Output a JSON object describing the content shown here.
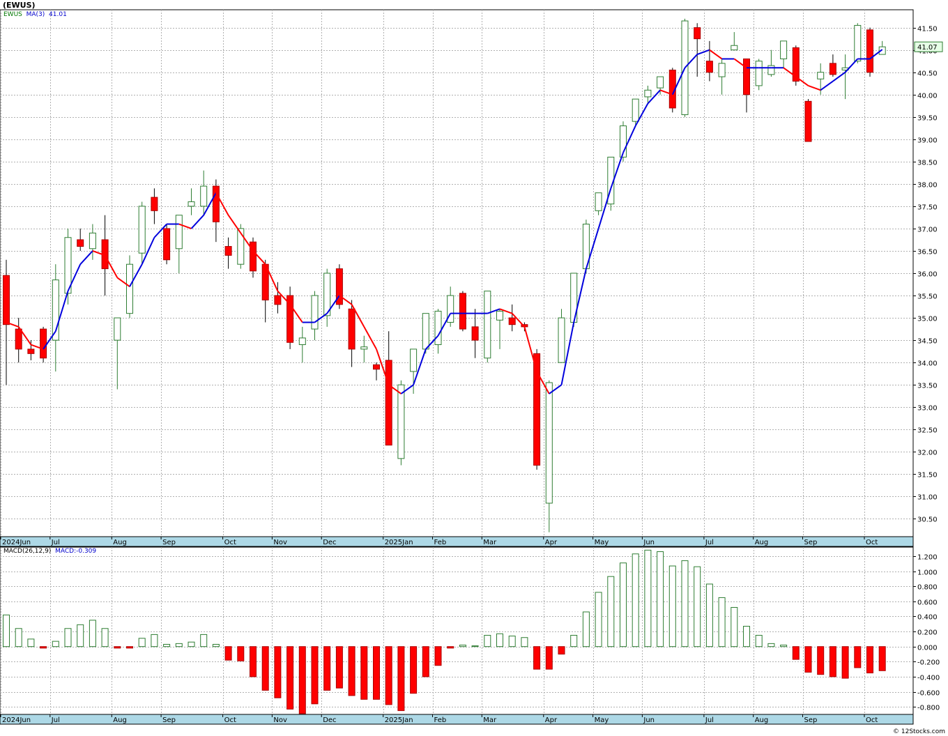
{
  "title": "(EWUS)",
  "price_legend": {
    "symbol": "EWUS",
    "ma_label": "MA(3)",
    "ma_value": "41.01"
  },
  "macd_legend": {
    "label": "MACD(26,12,9)",
    "value_label": "MACD:-0.309"
  },
  "last_price_tag": "41.07",
  "credit": "© 12Stocks.com",
  "colors": {
    "up": "#2e7d32",
    "down": "#ff0000",
    "ma_up": "#0000dd",
    "ma_down": "#ff0000",
    "axis_band": "#add8e6"
  },
  "chart_data": [
    {
      "type": "candlestick",
      "symbol": "EWUS",
      "interval": "weekly",
      "ylim": [
        30.1,
        41.9
      ],
      "y_ticks": [
        "30.50",
        "31.00",
        "31.50",
        "32.00",
        "32.50",
        "33.00",
        "33.50",
        "34.00",
        "34.50",
        "35.00",
        "35.50",
        "36.00",
        "36.50",
        "37.00",
        "37.50",
        "38.00",
        "38.50",
        "39.00",
        "39.50",
        "40.00",
        "40.50",
        "41.00",
        "41.50"
      ],
      "x_labels": [
        {
          "label": "2024Jun",
          "w": 0
        },
        {
          "label": "Jul",
          "w": 4
        },
        {
          "label": "Aug",
          "w": 9
        },
        {
          "label": "Sep",
          "w": 13
        },
        {
          "label": "Oct",
          "w": 18
        },
        {
          "label": "Nov",
          "w": 22
        },
        {
          "label": "Dec",
          "w": 26
        },
        {
          "label": "2025Jan",
          "w": 31
        },
        {
          "label": "Feb",
          "w": 35
        },
        {
          "label": "Mar",
          "w": 39
        },
        {
          "label": "Apr",
          "w": 44
        },
        {
          "label": "May",
          "w": 48
        },
        {
          "label": "Jun",
          "w": 52
        },
        {
          "label": "Jul",
          "w": 57
        },
        {
          "label": "Aug",
          "w": 61
        },
        {
          "label": "Sep",
          "w": 65
        },
        {
          "label": "Oct",
          "w": 70
        }
      ],
      "candles": [
        [
          35.95,
          36.3,
          33.5,
          34.85
        ],
        [
          34.75,
          35.0,
          34.0,
          34.3
        ],
        [
          34.3,
          34.5,
          34.05,
          34.2
        ],
        [
          34.75,
          34.8,
          34.0,
          34.1
        ],
        [
          34.5,
          36.2,
          33.8,
          35.85
        ],
        [
          35.55,
          37.0,
          35.3,
          36.8
        ],
        [
          36.75,
          37.0,
          36.5,
          36.6
        ],
        [
          36.55,
          37.1,
          36.3,
          36.9
        ],
        [
          36.75,
          37.3,
          35.5,
          36.1
        ],
        [
          34.5,
          35.0,
          33.4,
          35.0
        ],
        [
          35.1,
          36.4,
          35.0,
          36.2
        ],
        [
          36.45,
          37.6,
          36.2,
          37.5
        ],
        [
          37.7,
          37.9,
          37.1,
          37.4
        ],
        [
          37.0,
          37.1,
          36.2,
          36.3
        ],
        [
          36.55,
          37.3,
          36.0,
          37.3
        ],
        [
          37.5,
          37.9,
          37.3,
          37.6
        ],
        [
          37.5,
          38.3,
          37.3,
          37.95
        ],
        [
          37.95,
          38.1,
          36.7,
          37.15
        ],
        [
          36.6,
          36.8,
          36.1,
          36.4
        ],
        [
          36.2,
          37.1,
          36.1,
          37.0
        ],
        [
          36.7,
          36.8,
          35.9,
          36.05
        ],
        [
          36.2,
          36.3,
          34.9,
          35.4
        ],
        [
          35.5,
          35.8,
          35.1,
          35.3
        ],
        [
          35.5,
          35.7,
          34.3,
          34.45
        ],
        [
          34.4,
          34.8,
          34.0,
          34.55
        ],
        [
          34.75,
          35.6,
          34.5,
          35.5
        ],
        [
          35.05,
          36.1,
          34.8,
          36.0
        ],
        [
          36.1,
          36.2,
          35.2,
          35.3
        ],
        [
          35.2,
          35.4,
          33.9,
          34.3
        ],
        [
          34.3,
          34.6,
          34.0,
          34.35
        ],
        [
          33.95,
          34.0,
          33.6,
          33.85
        ],
        [
          34.05,
          34.7,
          32.2,
          32.15
        ],
        [
          31.85,
          33.6,
          31.7,
          33.5
        ],
        [
          33.8,
          34.3,
          33.3,
          34.3
        ],
        [
          34.3,
          35.0,
          34.2,
          35.1
        ],
        [
          34.4,
          35.2,
          34.2,
          35.15
        ],
        [
          34.9,
          35.7,
          34.8,
          35.5
        ],
        [
          35.55,
          35.6,
          34.7,
          34.75
        ],
        [
          34.8,
          35.2,
          34.1,
          34.5
        ],
        [
          34.1,
          35.6,
          34.0,
          35.6
        ],
        [
          34.95,
          35.2,
          34.3,
          35.15
        ],
        [
          35.0,
          35.3,
          34.7,
          34.85
        ],
        [
          34.85,
          34.9,
          34.7,
          34.8
        ],
        [
          34.2,
          34.3,
          31.6,
          31.7
        ],
        [
          30.85,
          33.6,
          30.2,
          33.55
        ],
        [
          34.0,
          35.2,
          34.0,
          35.0
        ],
        [
          34.9,
          36.0,
          34.8,
          36.0
        ],
        [
          36.1,
          37.2,
          36.0,
          37.1
        ],
        [
          37.4,
          37.8,
          37.3,
          37.8
        ],
        [
          37.55,
          38.6,
          37.4,
          38.6
        ],
        [
          38.6,
          39.4,
          38.5,
          39.3
        ],
        [
          39.4,
          39.9,
          39.3,
          39.9
        ],
        [
          39.95,
          40.2,
          39.8,
          40.1
        ],
        [
          40.15,
          40.4,
          40.0,
          40.4
        ],
        [
          40.55,
          40.6,
          39.6,
          39.7
        ],
        [
          39.55,
          41.7,
          39.5,
          41.65
        ],
        [
          41.5,
          41.6,
          40.4,
          41.25
        ],
        [
          40.75,
          41.2,
          40.3,
          40.5
        ],
        [
          40.4,
          40.8,
          40.0,
          40.7
        ],
        [
          41.0,
          41.4,
          41.0,
          41.1
        ],
        [
          40.8,
          40.8,
          39.6,
          40.0
        ],
        [
          40.2,
          40.8,
          40.1,
          40.75
        ],
        [
          40.45,
          41.0,
          40.4,
          40.65
        ],
        [
          40.8,
          41.2,
          40.6,
          41.2
        ],
        [
          41.05,
          41.1,
          40.2,
          40.3
        ],
        [
          39.85,
          39.9,
          39.0,
          38.95
        ],
        [
          40.35,
          40.7,
          40.0,
          40.5
        ],
        [
          40.7,
          40.9,
          40.4,
          40.45
        ],
        [
          40.55,
          40.9,
          39.9,
          40.6
        ],
        [
          40.75,
          41.6,
          40.7,
          41.55
        ],
        [
          41.45,
          41.5,
          40.4,
          40.5
        ],
        [
          40.9,
          41.2,
          40.9,
          41.07
        ]
      ],
      "ma": {
        "label": "MA(3)",
        "last": 41.01,
        "values": [
          34.9,
          34.8,
          34.4,
          34.3,
          34.7,
          35.6,
          36.2,
          36.5,
          36.4,
          35.9,
          35.7,
          36.2,
          36.8,
          37.1,
          37.1,
          37.0,
          37.3,
          37.8,
          37.3,
          36.9,
          36.5,
          36.2,
          35.6,
          35.3,
          34.9,
          34.9,
          35.1,
          35.5,
          35.3,
          34.8,
          34.3,
          33.5,
          33.3,
          33.5,
          34.3,
          34.6,
          35.1,
          35.1,
          35.1,
          35.1,
          35.2,
          35.1,
          34.8,
          33.8,
          33.3,
          33.5,
          34.9,
          36.1,
          37.0,
          37.9,
          38.7,
          39.3,
          39.8,
          40.1,
          40.0,
          40.6,
          40.9,
          41.0,
          40.8,
          40.8,
          40.6,
          40.6,
          40.6,
          40.6,
          40.4,
          40.2,
          40.1,
          40.3,
          40.5,
          40.8,
          40.8,
          41.01
        ]
      }
    },
    {
      "type": "bar",
      "name": "MACD(26,12,9)",
      "last": -0.309,
      "ylim": [
        -0.9,
        1.32
      ],
      "y_ticks": [
        "1.200",
        "1.000",
        "0.800",
        "0.600",
        "0.400",
        "0.200",
        "0.000",
        "-0.200",
        "-0.400",
        "-0.600",
        "-0.800"
      ],
      "x_labels": [
        {
          "label": "2024Jun",
          "w": 0
        },
        {
          "label": "Jul",
          "w": 4
        },
        {
          "label": "Aug",
          "w": 9
        },
        {
          "label": "Sep",
          "w": 13
        },
        {
          "label": "Oct",
          "w": 18
        },
        {
          "label": "Nov",
          "w": 22
        },
        {
          "label": "Dec",
          "w": 26
        },
        {
          "label": "2025Jan",
          "w": 31
        },
        {
          "label": "Feb",
          "w": 35
        },
        {
          "label": "Mar",
          "w": 39
        },
        {
          "label": "Apr",
          "w": 44
        },
        {
          "label": "May",
          "w": 48
        },
        {
          "label": "Jun",
          "w": 52
        },
        {
          "label": "Jul",
          "w": 57
        },
        {
          "label": "Aug",
          "w": 61
        },
        {
          "label": "Sep",
          "w": 65
        },
        {
          "label": "Oct",
          "w": 70
        }
      ],
      "values": [
        0.42,
        0.24,
        0.1,
        -0.02,
        0.07,
        0.24,
        0.29,
        0.35,
        0.24,
        -0.02,
        -0.02,
        0.11,
        0.16,
        0.03,
        0.04,
        0.06,
        0.16,
        0.03,
        -0.18,
        -0.19,
        -0.4,
        -0.58,
        -0.68,
        -0.83,
        -0.89,
        -0.76,
        -0.58,
        -0.55,
        -0.65,
        -0.7,
        -0.7,
        -0.77,
        -0.85,
        -0.62,
        -0.4,
        -0.25,
        -0.02,
        0.02,
        0.01,
        0.15,
        0.17,
        0.14,
        0.12,
        -0.3,
        -0.3,
        -0.1,
        0.15,
        0.46,
        0.72,
        0.93,
        1.11,
        1.23,
        1.28,
        1.26,
        1.07,
        1.14,
        1.06,
        0.83,
        0.65,
        0.52,
        0.27,
        0.15,
        0.04,
        0.02,
        -0.17,
        -0.34,
        -0.37,
        -0.4,
        -0.42,
        -0.28,
        -0.35,
        -0.32
      ]
    }
  ]
}
